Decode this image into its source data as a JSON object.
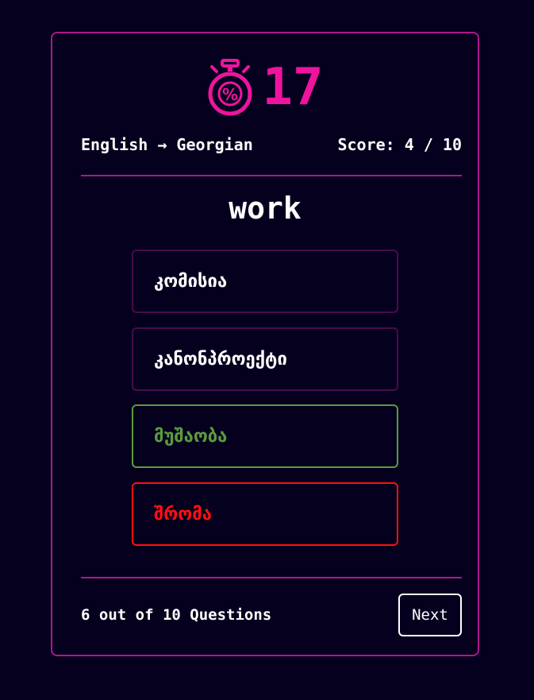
{
  "timer": {
    "icon": "stopwatch-percent-icon",
    "value": "17",
    "color": "#f0139e"
  },
  "direction": "English → Georgian",
  "score": "Score: 4 / 10",
  "word": "work",
  "options": [
    {
      "label": "კომისია",
      "state": "default"
    },
    {
      "label": "კანონპროექტი",
      "state": "default"
    },
    {
      "label": "მუშაობა",
      "state": "correct"
    },
    {
      "label": "შრომა",
      "state": "wrong"
    }
  ],
  "progress": "6 out of 10 Questions",
  "next_label": "Next",
  "colors": {
    "background": "#05001e",
    "accent": "#b0158f",
    "correct": "#5b9b3c",
    "wrong": "#ff1010"
  }
}
